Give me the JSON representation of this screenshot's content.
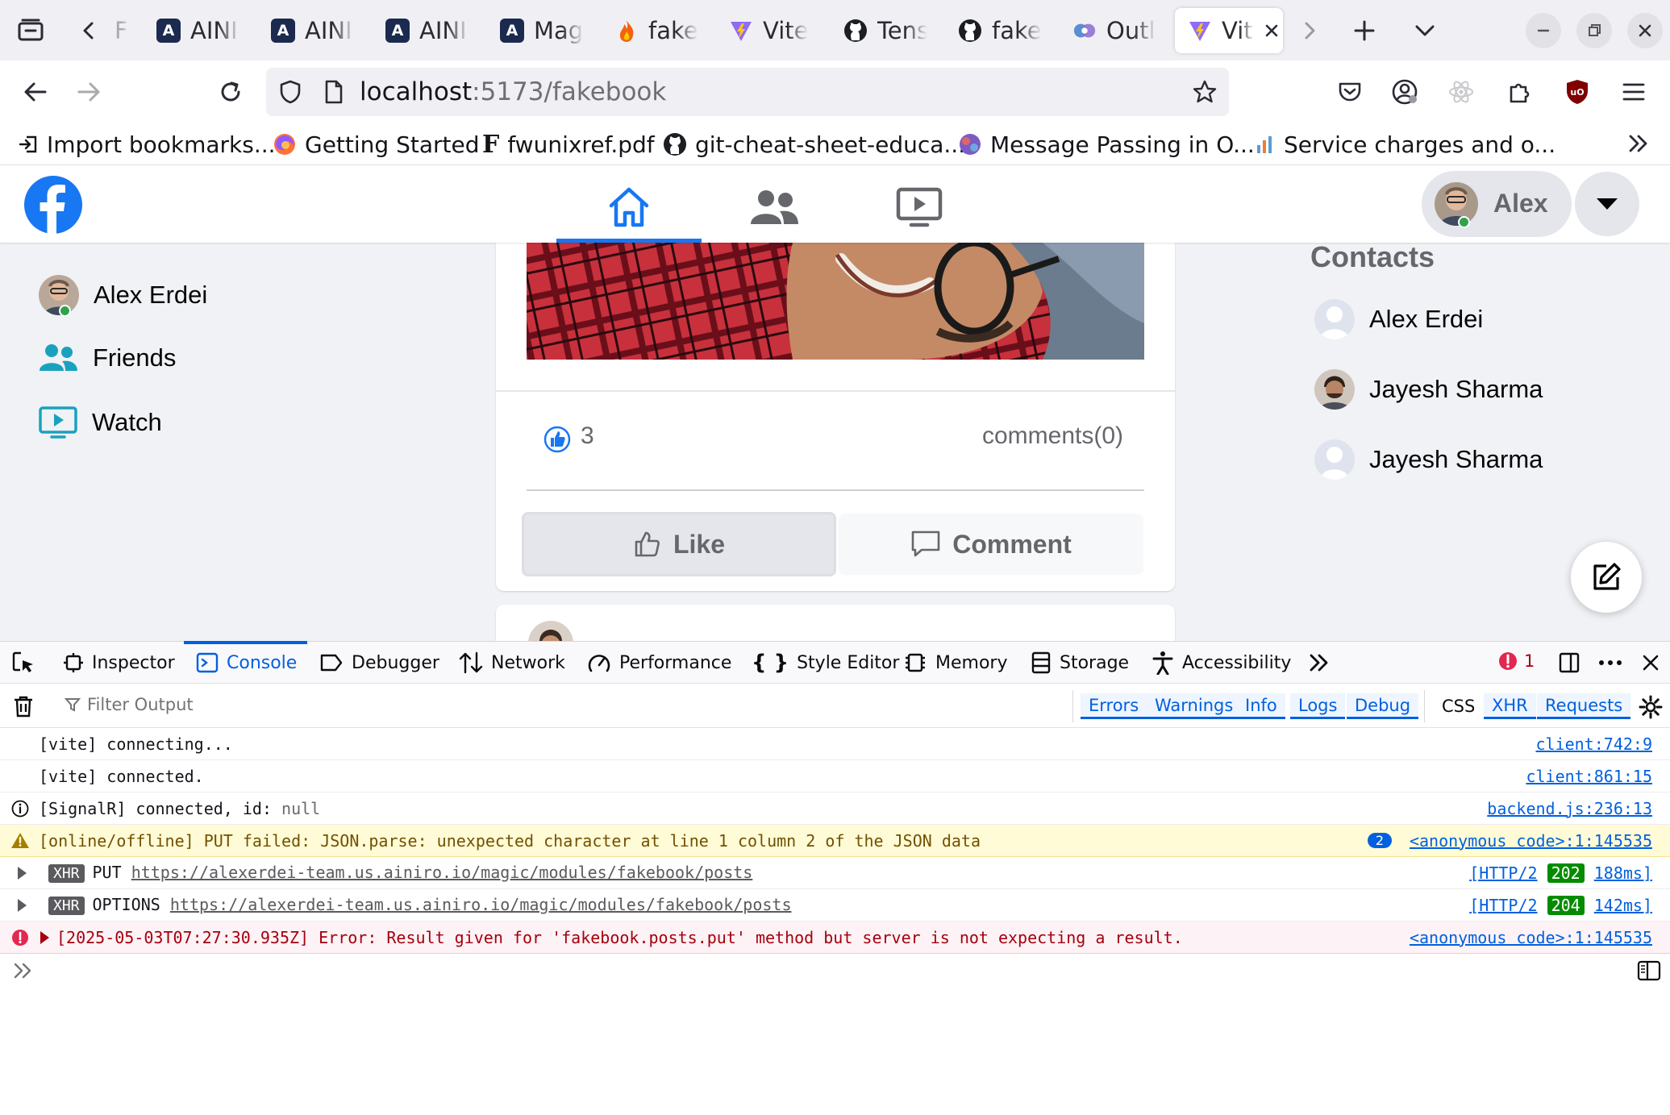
{
  "browser": {
    "tabs": [
      {
        "label": "F",
        "favicon": "firefox-view"
      },
      {
        "label": "AINIRO",
        "favicon": "ainiro-logo"
      },
      {
        "label": "AINIRO",
        "favicon": "ainiro-logo"
      },
      {
        "label": "AINIRO",
        "favicon": "ainiro-logo"
      },
      {
        "label": "Magic",
        "favicon": "ainiro-logo"
      },
      {
        "label": "fakebook",
        "favicon": "fire-logo"
      },
      {
        "label": "Vite",
        "favicon": "vite-logo"
      },
      {
        "label": "Tensor",
        "favicon": "github-logo"
      },
      {
        "label": "fakebook",
        "favicon": "github-logo"
      },
      {
        "label": "Outline",
        "favicon": "outline-logo"
      },
      {
        "label": "Vite",
        "favicon": "vite-logo",
        "active": true
      }
    ],
    "url": {
      "host": "localhost",
      "rest": ":5173/fakebook"
    },
    "bookmarks": [
      {
        "label": "Import bookmarks...",
        "icon": "import-icon"
      },
      {
        "label": "Getting Started",
        "icon": "firefox-logo"
      },
      {
        "label": "fwunixref.pdf",
        "icon": "f-letter-icon"
      },
      {
        "label": "git-cheat-sheet-educa...",
        "icon": "github-logo"
      },
      {
        "label": "Message Passing in O...",
        "icon": "globe-icon"
      },
      {
        "label": "Service charges and o...",
        "icon": "chart-icon"
      }
    ]
  },
  "app": {
    "user_name": "Alex",
    "sidebar": [
      {
        "label": "Alex Erdei"
      },
      {
        "label": "Friends"
      },
      {
        "label": "Watch"
      }
    ],
    "post": {
      "likes": "3",
      "comments": "comments(0)",
      "like_label": "Like",
      "comment_label": "Comment"
    },
    "contacts": {
      "title": "Contacts",
      "items": [
        {
          "name": "Alex Erdei"
        },
        {
          "name": "Jayesh Sharma"
        },
        {
          "name": "Jayesh Sharma"
        }
      ]
    },
    "colors": {
      "brand": "#1877f2",
      "teal": "#1aa1be"
    }
  },
  "devtools": {
    "tabs": [
      "Inspector",
      "Console",
      "Debugger",
      "Network",
      "Performance",
      "Style Editor",
      "Memory",
      "Storage",
      "Accessibility"
    ],
    "error_count": "1",
    "filter_placeholder": "Filter Output",
    "filters": [
      "Errors",
      "Warnings",
      "Info",
      "Logs",
      "Debug",
      "CSS",
      "XHR",
      "Requests"
    ],
    "logs": [
      {
        "text": "[vite] connecting...",
        "src": "client:742:9"
      },
      {
        "text": "[vite] connected.",
        "src": "client:861:15"
      },
      {
        "text": "[SignalR] connected, id: ",
        "extra": "null",
        "src": "backend.js:236:13"
      },
      {
        "text": "[online/offline] PUT failed: JSON.parse: unexpected character at line 1 column 2 of the JSON data",
        "badge": "2",
        "src": "<anonymous code>:1:145535"
      },
      {
        "tag": "XHR",
        "method": "PUT",
        "url": "https://alexerdei-team.us.ainiro.io/magic/modules/fakebook/posts",
        "proto": "[HTTP/2",
        "status": "202",
        "time": "188ms]"
      },
      {
        "tag": "XHR",
        "method": "OPTIONS",
        "url": "https://alexerdei-team.us.ainiro.io/magic/modules/fakebook/posts",
        "proto": "[HTTP/2",
        "status": "204",
        "time": "142ms]"
      },
      {
        "text": "[2025-05-03T07:27:30.935Z] Error: Result given for 'fakebook.posts.put' method but server is not expecting a result.",
        "src": "<anonymous code>:1:145535"
      }
    ]
  }
}
